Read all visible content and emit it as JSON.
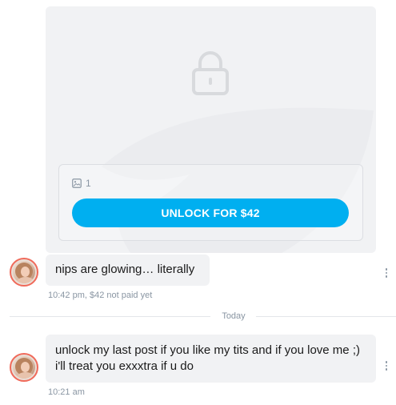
{
  "locked_post": {
    "media_count": "1",
    "unlock_label": "UNLOCK FOR $42"
  },
  "messages": [
    {
      "text": "nips are glowing… literally",
      "time": "10:42 pm,",
      "status": "$42 not paid yet"
    },
    {
      "text": "unlock my last post if you like my tits and if you love me ;) i'll treat you exxxtra if u do",
      "time": "10:21 am"
    }
  ],
  "divider": {
    "label": "Today"
  },
  "colors": {
    "accent": "#00aff0",
    "bubble": "#f1f2f4",
    "meta": "#8a96a3",
    "avatar_ring": "#f06a5a"
  },
  "icons": [
    "lock-icon",
    "image-icon",
    "more-vertical-icon"
  ]
}
